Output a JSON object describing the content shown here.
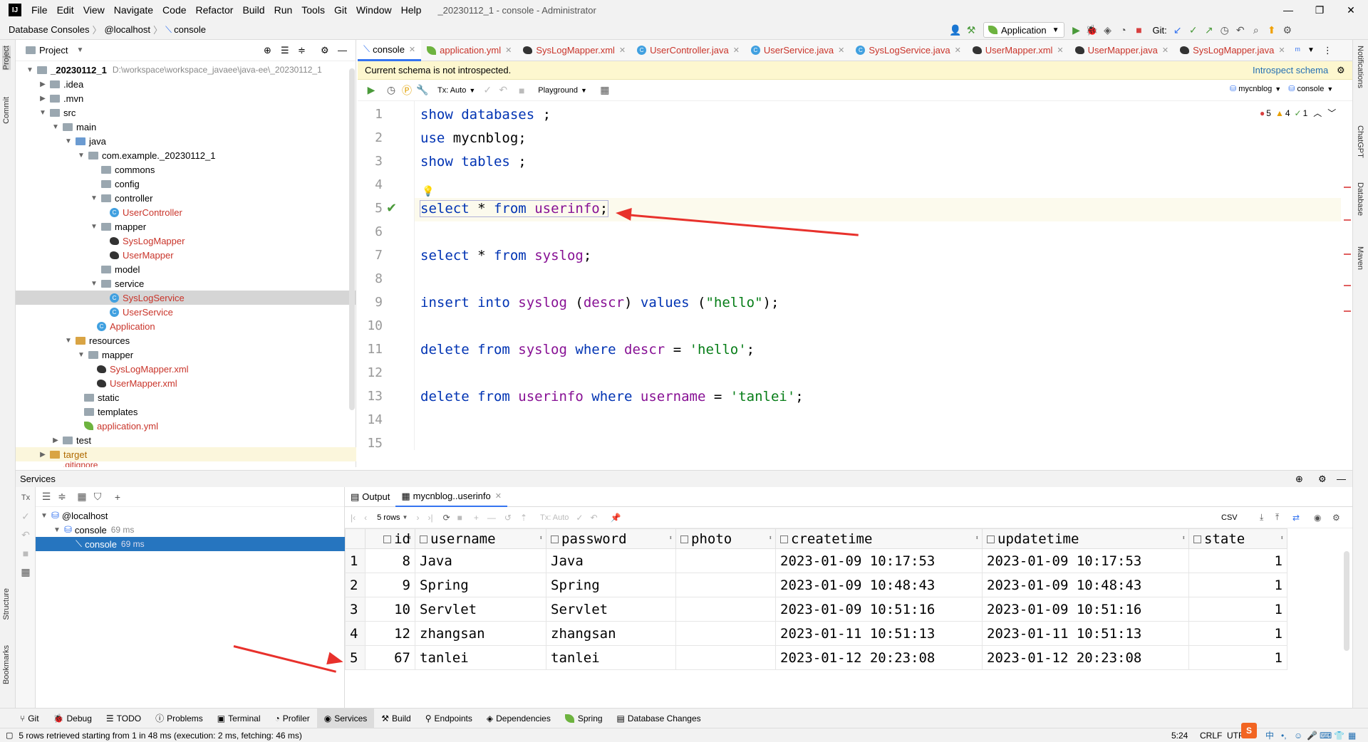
{
  "menubar": {
    "logo": "IJ",
    "items": [
      "File",
      "Edit",
      "View",
      "Navigate",
      "Code",
      "Refactor",
      "Build",
      "Run",
      "Tools",
      "Git",
      "Window",
      "Help"
    ],
    "title": "_20230112_1 - console - Administrator"
  },
  "navbar": {
    "crumbs": [
      "Database Consoles",
      "@localhost",
      "console"
    ],
    "run_config": "Application",
    "git_label": "Git:"
  },
  "side": {
    "project": "Project",
    "commit": "Commit",
    "structure": "Structure",
    "bookmarks": "Bookmarks",
    "notifications": "Notifications",
    "chatgpt": "ChatGPT",
    "database": "Database",
    "maven": "Maven"
  },
  "project": {
    "title": "Project",
    "root_name": "_20230112_1",
    "root_path": "D:\\workspace\\workspace_javaee\\java-ee\\_20230112_1",
    "items": [
      ".idea",
      ".mvn",
      "src",
      "main",
      "java",
      "com.example._20230112_1",
      "commons",
      "config",
      "controller",
      "UserController",
      "mapper",
      "SysLogMapper",
      "UserMapper",
      "model",
      "service",
      "SysLogService",
      "UserService",
      "Application",
      "resources",
      "mapper",
      "SysLogMapper.xml",
      "UserMapper.xml",
      "static",
      "templates",
      "application.yml",
      "test",
      "target",
      ".gitignore"
    ]
  },
  "editor": {
    "tabs": [
      "console",
      "application.yml",
      "SysLogMapper.xml",
      "UserController.java",
      "UserService.java",
      "SysLogService.java",
      "UserMapper.xml",
      "UserMapper.java",
      "SysLogMapper.java"
    ],
    "schema_msg": "Current schema is not introspected.",
    "introspect": "Introspect schema",
    "tx": "Tx: Auto",
    "playground": "Playground",
    "schema": "mycnblog",
    "console": "console",
    "errors": "5",
    "warnings": "4",
    "ok": "1",
    "line_numbers": [
      "1",
      "2",
      "3",
      "4",
      "5",
      "6",
      "7",
      "8",
      "9",
      "10",
      "11",
      "12",
      "13",
      "14",
      "15"
    ]
  },
  "code": {
    "l1": [
      "show databases",
      " ;"
    ],
    "l2": [
      "use",
      " mycnblog;"
    ],
    "l3": [
      "show tables",
      " ;"
    ],
    "l5": [
      "select",
      " * ",
      "from",
      " ",
      "userinfo",
      ";"
    ],
    "l7": [
      "select",
      " * ",
      "from",
      " ",
      "syslog",
      ";"
    ],
    "l9": [
      "insert into",
      " ",
      "syslog",
      " (",
      "descr",
      ") ",
      "values",
      " (",
      "\"hello\"",
      ");"
    ],
    "l11": [
      "delete from",
      " ",
      "syslog",
      " ",
      "where",
      " ",
      "descr",
      " = ",
      "'hello'",
      ";"
    ],
    "l13": [
      "delete from",
      " ",
      "userinfo",
      " ",
      "where",
      " ",
      "username",
      " = ",
      "'tanlei'",
      ";"
    ]
  },
  "services": {
    "title": "Services",
    "host": "@localhost",
    "console": "console",
    "console_ms": "69 ms",
    "session": "console",
    "session_ms": "69 ms",
    "tx_label": "Tx"
  },
  "results": {
    "tab_output": "Output",
    "tab_table": "mycnblog..userinfo",
    "rows_label": "5 rows",
    "tx": "Tx: Auto",
    "csv": "CSV",
    "columns": [
      "id",
      "username",
      "password",
      "photo",
      "createtime",
      "updatetime",
      "state"
    ],
    "rows": [
      {
        "n": "1",
        "id": "8",
        "username": "Java",
        "password": "Java",
        "photo": "",
        "createtime": "2023-01-09 10:17:53",
        "updatetime": "2023-01-09 10:17:53",
        "state": "1"
      },
      {
        "n": "2",
        "id": "9",
        "username": "Spring",
        "password": "Spring",
        "photo": "",
        "createtime": "2023-01-09 10:48:43",
        "updatetime": "2023-01-09 10:48:43",
        "state": "1"
      },
      {
        "n": "3",
        "id": "10",
        "username": "Servlet",
        "password": "Servlet",
        "photo": "",
        "createtime": "2023-01-09 10:51:16",
        "updatetime": "2023-01-09 10:51:16",
        "state": "1"
      },
      {
        "n": "4",
        "id": "12",
        "username": "zhangsan",
        "password": "zhangsan",
        "photo": "",
        "createtime": "2023-01-11 10:51:13",
        "updatetime": "2023-01-11 10:51:13",
        "state": "1"
      },
      {
        "n": "5",
        "id": "67",
        "username": "tanlei",
        "password": "tanlei",
        "photo": "",
        "createtime": "2023-01-12 20:23:08",
        "updatetime": "2023-01-12 20:23:08",
        "state": "1"
      }
    ]
  },
  "bottom_tabs": [
    "Git",
    "Debug",
    "TODO",
    "Problems",
    "Terminal",
    "Profiler",
    "Services",
    "Build",
    "Endpoints",
    "Dependencies",
    "Spring",
    "Database Changes"
  ],
  "status": {
    "msg": "5 rows retrieved starting from 1 in 48 ms (execution: 2 ms, fetching: 46 ms)",
    "pos": "5:24",
    "eol": "CRLF",
    "enc": "UTF"
  },
  "colors": {
    "accent": "#3574f0",
    "selection": "#2675bf",
    "annotation": "#e8312c"
  }
}
